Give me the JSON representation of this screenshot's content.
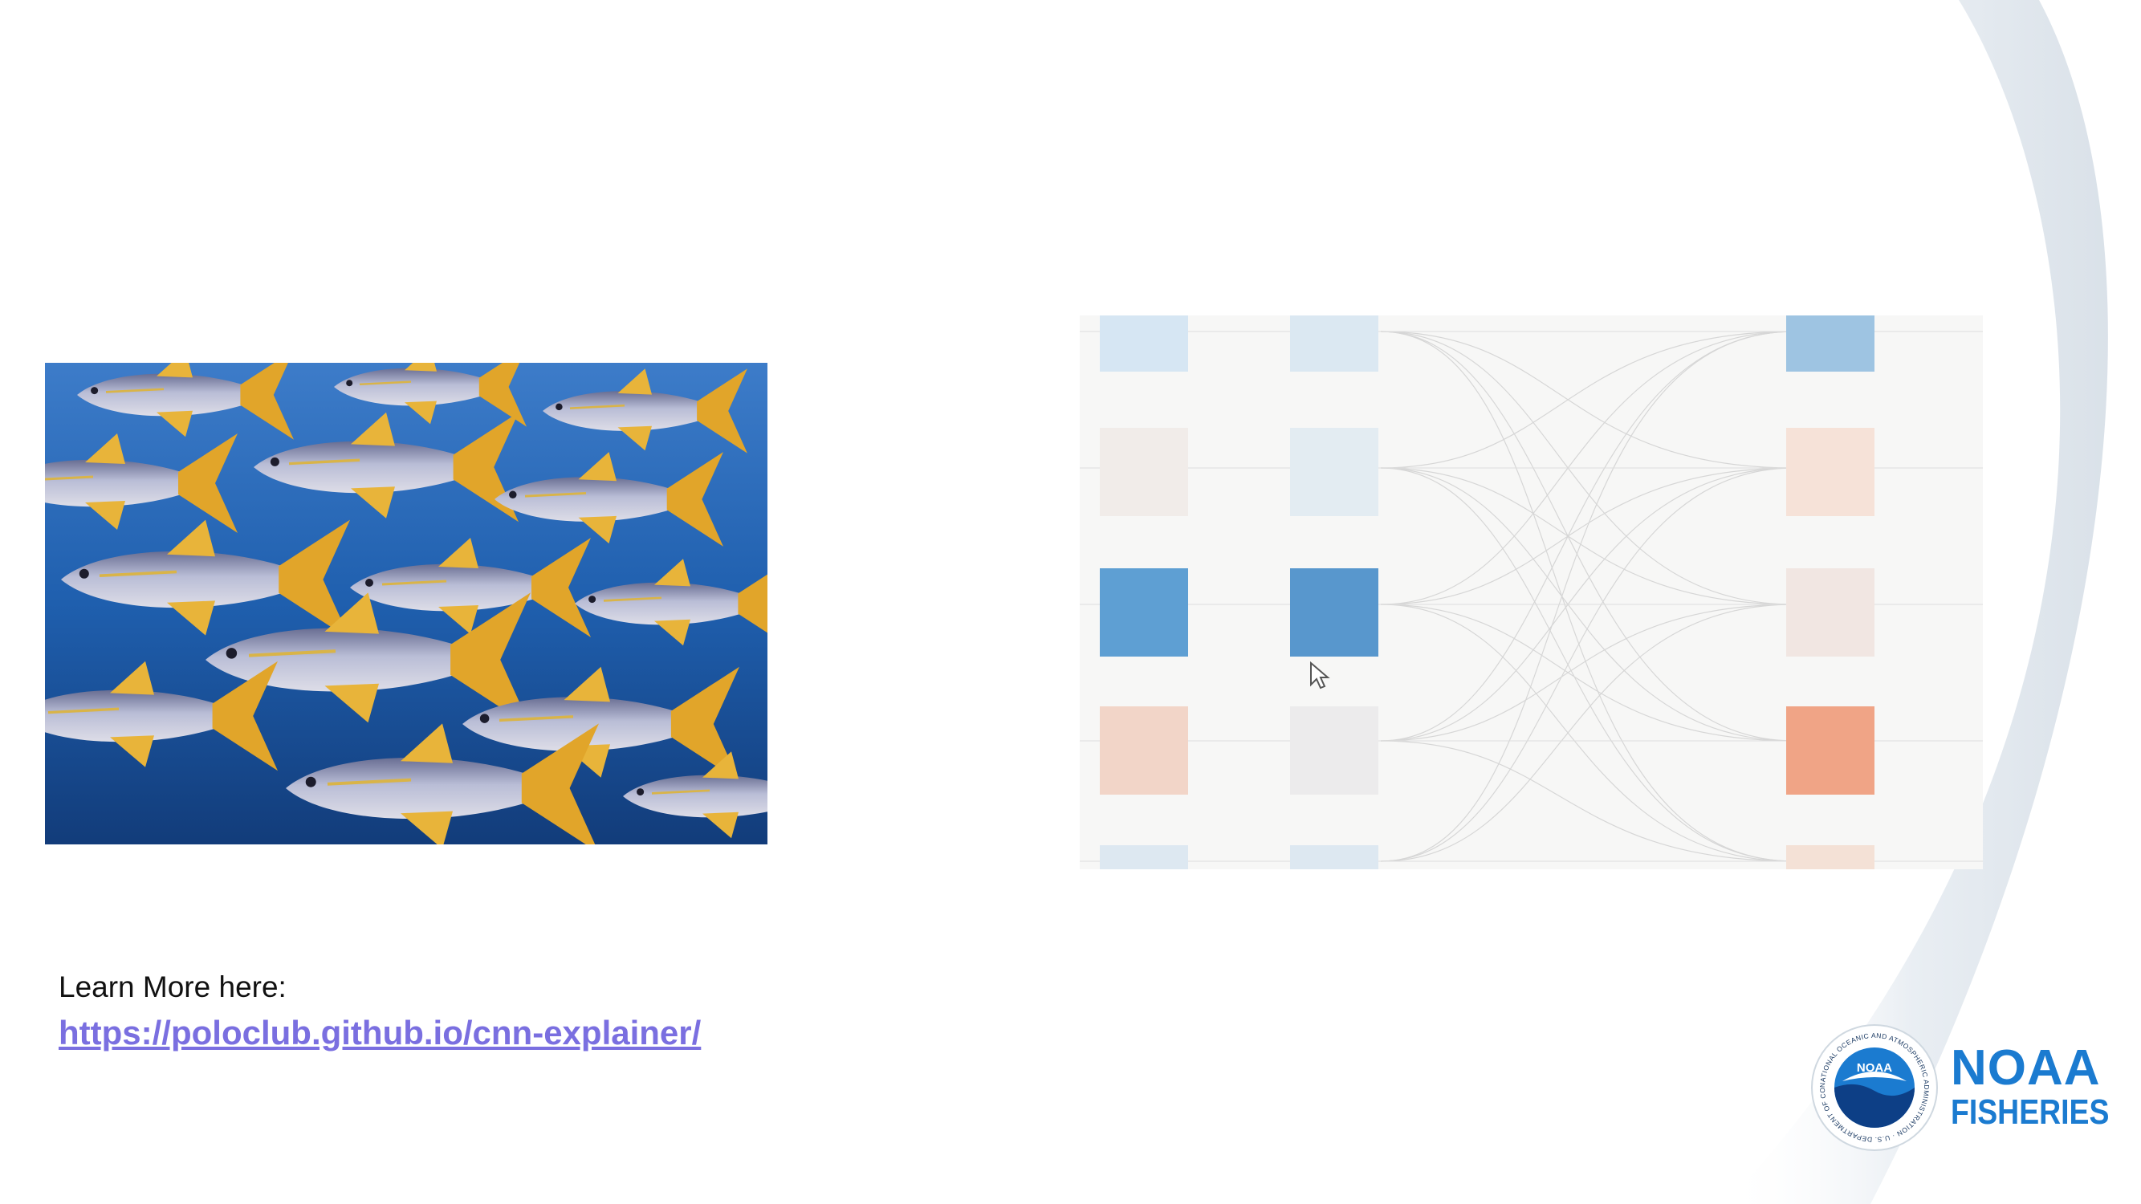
{
  "slide": {
    "learn_more": "Learn More here:",
    "link_text": "https://poloclub.github.io/cnn-explainer/",
    "photo_icon": "yellowfin-tuna-school-photo",
    "viz_icon": "cnn-explainer-animation",
    "logo": {
      "icon": "noaa-emblem",
      "seal_text": "NATIONAL OCEANIC AND ATMOSPHERIC ADMINISTRATION · U.S. DEPARTMENT OF COMMERCE",
      "badge": "NOAA",
      "wordmark_top": "NOAA",
      "wordmark_bottom": "FISHERIES"
    },
    "colors": {
      "brand_blue": "#1b7bd0",
      "link": "#7a6fe0",
      "ocean": "#1f5fae"
    }
  }
}
